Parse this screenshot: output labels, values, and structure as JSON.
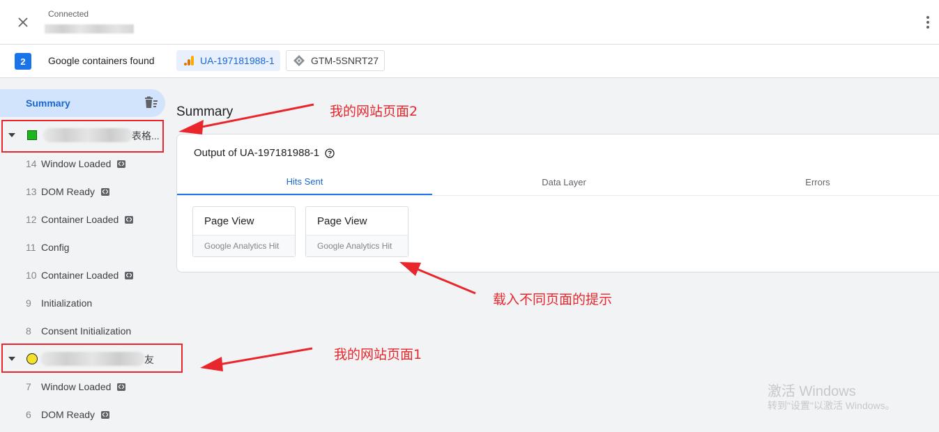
{
  "header": {
    "status": "Connected"
  },
  "container_bar": {
    "count": "2",
    "label": "Google containers found",
    "containers": [
      {
        "id": "UA-197181988-1",
        "icon": "analytics-icon",
        "active": true
      },
      {
        "id": "GTM-5SNRT27",
        "icon": "gtm-diamond-icon",
        "active": false
      }
    ]
  },
  "sidebar": {
    "summary_label": "Summary",
    "page_group_1": {
      "tail": "表格...",
      "indicator_color": "#1fb51f"
    },
    "events_1": [
      {
        "num": "14",
        "name": "Window Loaded",
        "has_code": true
      },
      {
        "num": "13",
        "name": "DOM Ready",
        "has_code": true
      },
      {
        "num": "12",
        "name": "Container Loaded",
        "has_code": true
      },
      {
        "num": "11",
        "name": "Config",
        "has_code": false
      },
      {
        "num": "10",
        "name": "Container Loaded",
        "has_code": true
      },
      {
        "num": "9",
        "name": "Initialization",
        "has_code": false
      },
      {
        "num": "8",
        "name": "Consent Initialization",
        "has_code": false
      }
    ],
    "page_group_2": {
      "tail": "友",
      "indicator_color": "#f5e02a"
    },
    "events_2": [
      {
        "num": "7",
        "name": "Window Loaded",
        "has_code": true
      },
      {
        "num": "6",
        "name": "DOM Ready",
        "has_code": true
      }
    ]
  },
  "main": {
    "title": "Summary",
    "output_title": "Output of UA-197181988-1",
    "tabs": [
      {
        "label": "Hits Sent",
        "active": true
      },
      {
        "label": "Data Layer",
        "active": false
      },
      {
        "label": "Errors",
        "active": false
      }
    ],
    "hits": [
      {
        "title": "Page View",
        "subtitle": "Google Analytics Hit"
      },
      {
        "title": "Page View",
        "subtitle": "Google Analytics Hit"
      }
    ]
  },
  "annotations": {
    "page2": "我的网站页面2",
    "hint": "载入不同页面的提示",
    "page1": "我的网站页面1",
    "color": "#e8262b"
  },
  "watermark": {
    "line1": "激活 Windows",
    "line2": "转到\"设置\"以激活 Windows。"
  }
}
